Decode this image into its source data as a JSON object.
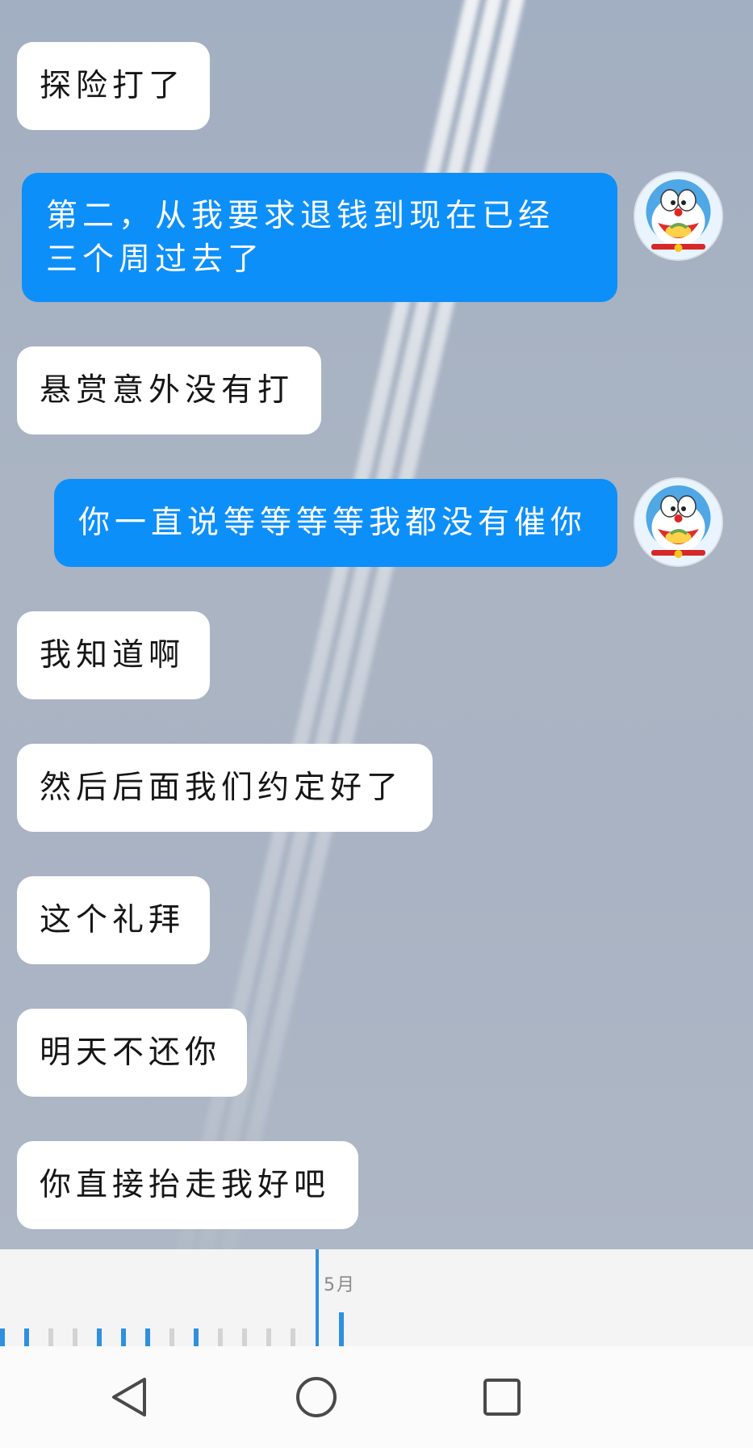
{
  "messages": [
    {
      "side": "in",
      "text": "探险打了"
    },
    {
      "side": "out",
      "text": "第二，从我要求退钱到现在已经三个周过去了",
      "line1": "第二，从我要求退钱到现在已经",
      "line2": "三个周过去了"
    },
    {
      "side": "in",
      "text": "悬赏意外没有打"
    },
    {
      "side": "out",
      "text": "你一直说等等等等我都没有催你"
    },
    {
      "side": "in",
      "text": "我知道啊"
    },
    {
      "side": "in",
      "text": "然后后面我们约定好了"
    },
    {
      "side": "in",
      "text": "这个礼拜"
    },
    {
      "side": "in",
      "text": "明天不还你"
    },
    {
      "side": "in",
      "text": "你直接抬走我好吧"
    }
  ],
  "timeline": {
    "month_label": "5月"
  },
  "navigation": {
    "back_icon": "triangle-back-icon",
    "home_icon": "circle-home-icon",
    "recents_icon": "square-recents-icon"
  },
  "colors": {
    "outgoing_bubble": "#0d8ff9",
    "incoming_bubble": "#ffffff",
    "timeline_accent": "#2f8fe0"
  }
}
